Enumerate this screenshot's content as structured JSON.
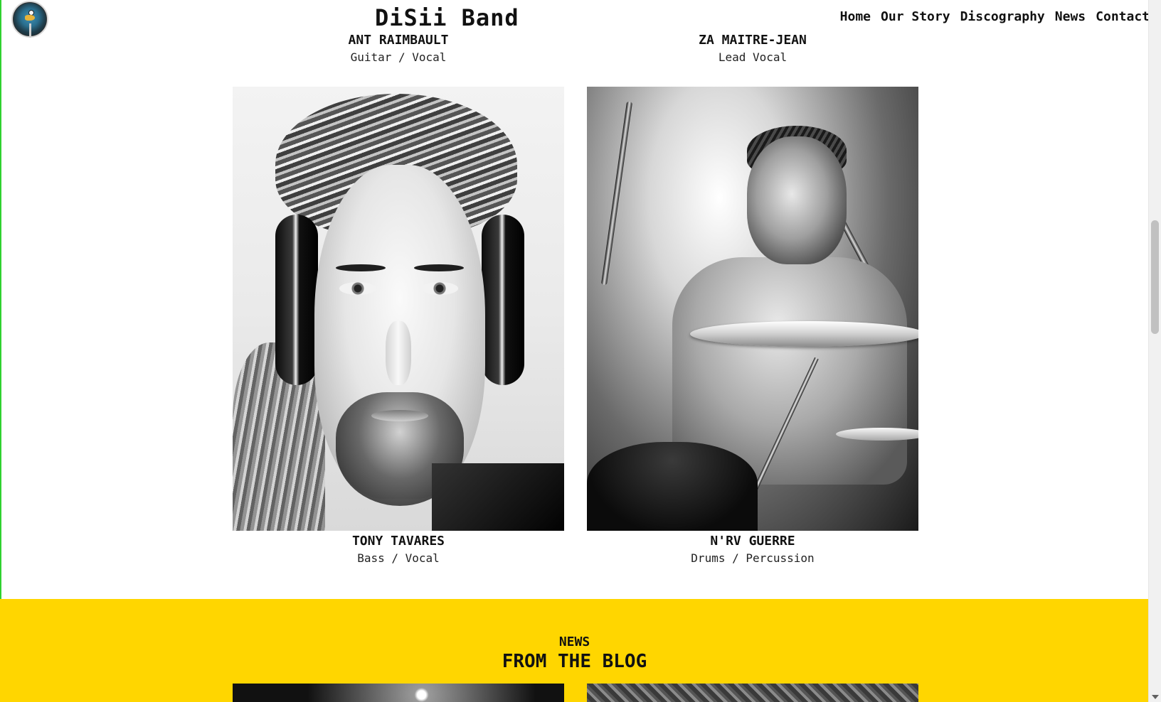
{
  "header": {
    "brand": "DiSii Band",
    "nav": [
      "Home",
      "Our Story",
      "Discography",
      "News",
      "Contact"
    ],
    "logo_icon": "duck-microphone-logo-icon"
  },
  "members_top": [
    {
      "name": "ANT RAIMBAULT",
      "role": "Guitar / Vocal"
    },
    {
      "name": "ZA MAITRE-JEAN",
      "role": "Lead Vocal"
    }
  ],
  "members": [
    {
      "name": "TONY TAVARES",
      "role": "Bass / Vocal",
      "photo": "portrait with headphones"
    },
    {
      "name": "N'RV GUERRE",
      "role": "Drums / Percussion",
      "photo": "drummer playing"
    }
  ],
  "news": {
    "kicker": "NEWS",
    "title": "FROM THE BLOG"
  },
  "colors": {
    "accent_yellow": "#ffd600",
    "text": "#111111",
    "background": "#ffffff"
  }
}
